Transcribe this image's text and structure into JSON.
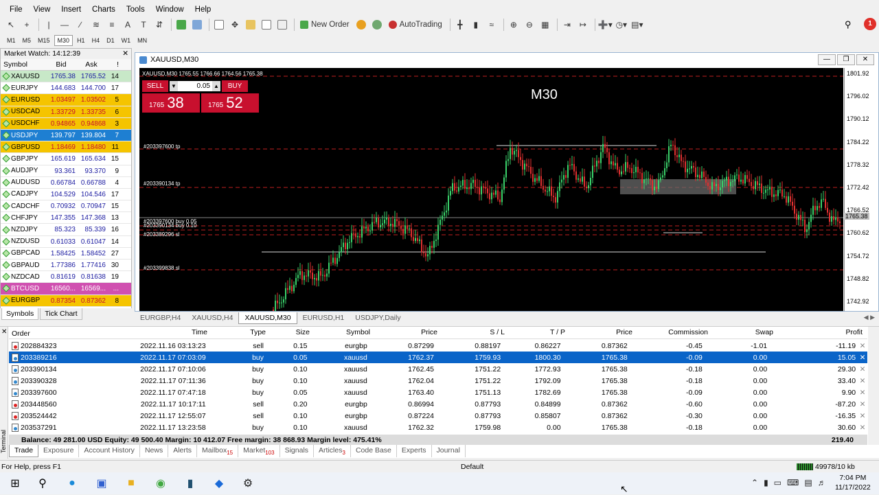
{
  "menu": [
    "File",
    "View",
    "Insert",
    "Charts",
    "Tools",
    "Window",
    "Help"
  ],
  "toolbar": {
    "new_order": "New Order",
    "autotrading": "AutoTrading"
  },
  "timeframes": [
    "M1",
    "M5",
    "M15",
    "M30",
    "H1",
    "H4",
    "D1",
    "W1",
    "MN"
  ],
  "timeframe_selected": "M30",
  "notification_count": "1",
  "market_watch": {
    "title": "Market Watch: 14:12:39",
    "headers": [
      "Symbol",
      "Bid",
      "Ask",
      "!"
    ],
    "rows": [
      {
        "symbol": "XAUUSD",
        "bid": "1765.38",
        "ask": "1765.52",
        "spread": "14",
        "bg": "#c8e8c8"
      },
      {
        "symbol": "EURJPY",
        "bid": "144.683",
        "ask": "144.700",
        "spread": "17",
        "bg": "#ffffff"
      },
      {
        "symbol": "EURUSD",
        "bid": "1.03497",
        "ask": "1.03502",
        "spread": "5",
        "bg": "#f5c400"
      },
      {
        "symbol": "USDCAD",
        "bid": "1.33729",
        "ask": "1.33735",
        "spread": "6",
        "bg": "#f5c400"
      },
      {
        "symbol": "USDCHF",
        "bid": "0.94865",
        "ask": "0.94868",
        "spread": "3",
        "bg": "#f5c400"
      },
      {
        "symbol": "USDJPY",
        "bid": "139.797",
        "ask": "139.804",
        "spread": "7",
        "bg": "#1e7fd2"
      },
      {
        "symbol": "GBPUSD",
        "bid": "1.18469",
        "ask": "1.18480",
        "spread": "11",
        "bg": "#f5c400"
      },
      {
        "symbol": "GBPJPY",
        "bid": "165.619",
        "ask": "165.634",
        "spread": "15",
        "bg": "#ffffff"
      },
      {
        "symbol": "AUDJPY",
        "bid": "93.361",
        "ask": "93.370",
        "spread": "9",
        "bg": "#ffffff"
      },
      {
        "symbol": "AUDUSD",
        "bid": "0.66784",
        "ask": "0.66788",
        "spread": "4",
        "bg": "#ffffff"
      },
      {
        "symbol": "CADJPY",
        "bid": "104.529",
        "ask": "104.546",
        "spread": "17",
        "bg": "#ffffff"
      },
      {
        "symbol": "CADCHF",
        "bid": "0.70932",
        "ask": "0.70947",
        "spread": "15",
        "bg": "#ffffff"
      },
      {
        "symbol": "CHFJPY",
        "bid": "147.355",
        "ask": "147.368",
        "spread": "13",
        "bg": "#ffffff"
      },
      {
        "symbol": "NZDJPY",
        "bid": "85.323",
        "ask": "85.339",
        "spread": "16",
        "bg": "#ffffff"
      },
      {
        "symbol": "NZDUSD",
        "bid": "0.61033",
        "ask": "0.61047",
        "spread": "14",
        "bg": "#ffffff"
      },
      {
        "symbol": "GBPCAD",
        "bid": "1.58425",
        "ask": "1.58452",
        "spread": "27",
        "bg": "#ffffff"
      },
      {
        "symbol": "GBPAUD",
        "bid": "1.77386",
        "ask": "1.77416",
        "spread": "30",
        "bg": "#ffffff"
      },
      {
        "symbol": "NZDCAD",
        "bid": "0.81619",
        "ask": "0.81638",
        "spread": "19",
        "bg": "#ffffff"
      },
      {
        "symbol": "BTCUSD",
        "bid": "16560...",
        "ask": "16569...",
        "spread": "...",
        "bg": "#d050b0"
      },
      {
        "symbol": "EURGBP",
        "bid": "0.87354",
        "ask": "0.87362",
        "spread": "8",
        "bg": "#f5c400"
      }
    ],
    "tabs": [
      "Symbols",
      "Tick Chart"
    ]
  },
  "chart": {
    "window_title": "XAUUSD,M30",
    "info_line": "XAUUSD,M30  1765.55 1766.66 1764.56 1765.38",
    "timeframe_label": "M30",
    "sell_label": "SELL",
    "buy_label": "BUY",
    "volume": "0.05",
    "sell_price_small": "1765",
    "sell_price_big": "38",
    "buy_price_small": "1765",
    "buy_price_big": "52",
    "y_ticks": [
      "1801.92",
      "1796.02",
      "1790.12",
      "1784.22",
      "1778.32",
      "1772.42",
      "1766.52",
      "1760.62",
      "1754.72",
      "1748.82",
      "1742.92"
    ],
    "current_price": "1765.38",
    "order_labels": [
      "#203397600 tp",
      "#203390134 tp",
      "#203397600 buy 0.05",
      "#203390134 buy 0.10",
      "#203389296 sl",
      "#203399838 sl"
    ],
    "tabs": [
      "EURGBP,H4",
      "XAUUSD,H4",
      "XAUUSD,M30",
      "EURUSD,H1",
      "USDJPY,Daily"
    ],
    "active_tab": "XAUUSD,M30"
  },
  "terminal": {
    "side_label": "Terminal",
    "headers": [
      "Order",
      "Time",
      "Type",
      "Size",
      "Symbol",
      "Price",
      "S / L",
      "T / P",
      "Price",
      "Commission",
      "Swap",
      "Profit"
    ],
    "rows": [
      {
        "order": "202884323",
        "time": "2022.11.16 03:13:23",
        "type": "sell",
        "size": "0.15",
        "symbol": "eurgbp",
        "price": "0.87299",
        "sl": "0.88197",
        "tp": "0.86227",
        "cur": "0.87362",
        "commission": "-0.45",
        "swap": "-1.01",
        "profit": "-11.19"
      },
      {
        "order": "203389216",
        "time": "2022.11.17 07:03:09",
        "type": "buy",
        "size": "0.05",
        "symbol": "xauusd",
        "price": "1762.37",
        "sl": "1759.93",
        "tp": "1800.30",
        "cur": "1765.38",
        "commission": "-0.09",
        "swap": "0.00",
        "profit": "15.05"
      },
      {
        "order": "203390134",
        "time": "2022.11.17 07:10:06",
        "type": "buy",
        "size": "0.10",
        "symbol": "xauusd",
        "price": "1762.45",
        "sl": "1751.22",
        "tp": "1772.93",
        "cur": "1765.38",
        "commission": "-0.18",
        "swap": "0.00",
        "profit": "29.30"
      },
      {
        "order": "203390328",
        "time": "2022.11.17 07:11:36",
        "type": "buy",
        "size": "0.10",
        "symbol": "xauusd",
        "price": "1762.04",
        "sl": "1751.22",
        "tp": "1792.09",
        "cur": "1765.38",
        "commission": "-0.18",
        "swap": "0.00",
        "profit": "33.40"
      },
      {
        "order": "203397600",
        "time": "2022.11.17 07:47:18",
        "type": "buy",
        "size": "0.05",
        "symbol": "xauusd",
        "price": "1763.40",
        "sl": "1751.13",
        "tp": "1782.69",
        "cur": "1765.38",
        "commission": "-0.09",
        "swap": "0.00",
        "profit": "9.90"
      },
      {
        "order": "203448560",
        "time": "2022.11.17 10:17:11",
        "type": "sell",
        "size": "0.20",
        "symbol": "eurgbp",
        "price": "0.86994",
        "sl": "0.87793",
        "tp": "0.84899",
        "cur": "0.87362",
        "commission": "-0.60",
        "swap": "0.00",
        "profit": "-87.20"
      },
      {
        "order": "203524442",
        "time": "2022.11.17 12:55:07",
        "type": "sell",
        "size": "0.10",
        "symbol": "eurgbp",
        "price": "0.87224",
        "sl": "0.87793",
        "tp": "0.85807",
        "cur": "0.87362",
        "commission": "-0.30",
        "swap": "0.00",
        "profit": "-16.35"
      },
      {
        "order": "203537291",
        "time": "2022.11.17 13:23:58",
        "type": "buy",
        "size": "0.10",
        "symbol": "xauusd",
        "price": "1762.32",
        "sl": "1759.98",
        "tp": "0.00",
        "cur": "1765.38",
        "commission": "-0.18",
        "swap": "0.00",
        "profit": "30.60"
      }
    ],
    "selected_row": 1,
    "balance_line": "Balance: 49 281.00 USD  Equity: 49 500.40  Margin: 10 412.07  Free margin: 38 868.93  Margin level: 475.41%",
    "total_profit": "219.40",
    "tabs": [
      {
        "label": "Trade",
        "badge": ""
      },
      {
        "label": "Exposure",
        "badge": ""
      },
      {
        "label": "Account History",
        "badge": ""
      },
      {
        "label": "News",
        "badge": ""
      },
      {
        "label": "Alerts",
        "badge": ""
      },
      {
        "label": "Mailbox",
        "badge": "15"
      },
      {
        "label": "Market",
        "badge": "103"
      },
      {
        "label": "Signals",
        "badge": ""
      },
      {
        "label": "Articles",
        "badge": "3"
      },
      {
        "label": "Code Base",
        "badge": ""
      },
      {
        "label": "Experts",
        "badge": ""
      },
      {
        "label": "Journal",
        "badge": ""
      }
    ]
  },
  "status": {
    "help": "For Help, press F1",
    "profile": "Default",
    "traffic": "49978/10 kb"
  },
  "taskbar": {
    "time": "7:04 PM",
    "date": "11/17/2022"
  }
}
